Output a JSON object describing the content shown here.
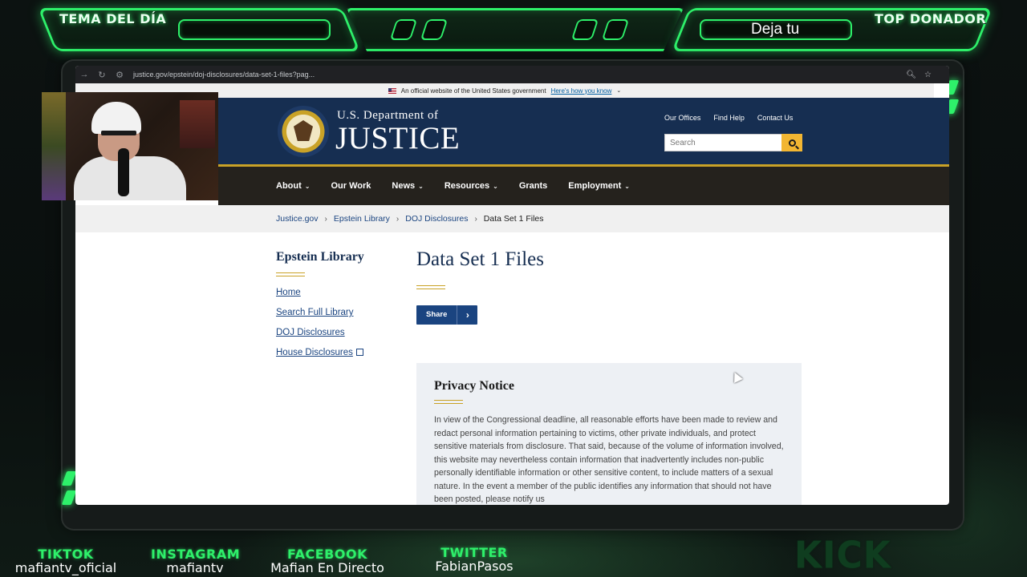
{
  "overlay": {
    "left_label": "TEMA DEL DÍA",
    "right_label": "TOP DONADOR",
    "ticker": "Deja tu",
    "socials": [
      {
        "network": "TIKTOK",
        "handle": "mafiantv_oficial"
      },
      {
        "network": "INSTAGRAM",
        "handle": "mafiantv"
      },
      {
        "network": "FACEBOOK",
        "handle": "Mafian En Directo"
      },
      {
        "network": "TWITTER",
        "handle": "FabianPasos"
      }
    ],
    "kick_logo": "KICK",
    "accent_color": "#2ef06a"
  },
  "browser": {
    "url": "justice.gov/epstein/doj-disclosures/data-set-1-files?pag..."
  },
  "gov_banner": {
    "text": "An official website of the United States government",
    "link": "Here's how you know"
  },
  "header": {
    "dept": "U.S. Department of",
    "name": "JUSTICE",
    "util_links": [
      "Our Offices",
      "Find Help",
      "Contact Us"
    ],
    "search_placeholder": "Search"
  },
  "nav": {
    "items": [
      {
        "label": "About",
        "dropdown": true
      },
      {
        "label": "Our Work",
        "dropdown": false
      },
      {
        "label": "News",
        "dropdown": true
      },
      {
        "label": "Resources",
        "dropdown": true
      },
      {
        "label": "Grants",
        "dropdown": false
      },
      {
        "label": "Employment",
        "dropdown": true
      }
    ]
  },
  "breadcrumbs": [
    "Justice.gov",
    "Epstein Library",
    "DOJ Disclosures",
    "Data Set 1 Files"
  ],
  "sidenav": {
    "title": "Epstein Library",
    "links": [
      "Home",
      "Search Full Library",
      "DOJ Disclosures",
      "House Disclosures"
    ]
  },
  "main": {
    "title": "Data Set 1 Files",
    "share_label": "Share"
  },
  "privacy": {
    "title": "Privacy Notice",
    "body": "In view of the Congressional deadline, all reasonable efforts have been made to review and redact personal information pertaining to victims, other private individuals, and protect sensitive materials from disclosure. That said, because of the volume of information involved, this website may nevertheless contain information that inadvertently includes non-public personally identifiable information or other sensitive content, to include matters of a sexual nature. In the event a member of the public identifies any information that should not have been posted, please notify us"
  }
}
